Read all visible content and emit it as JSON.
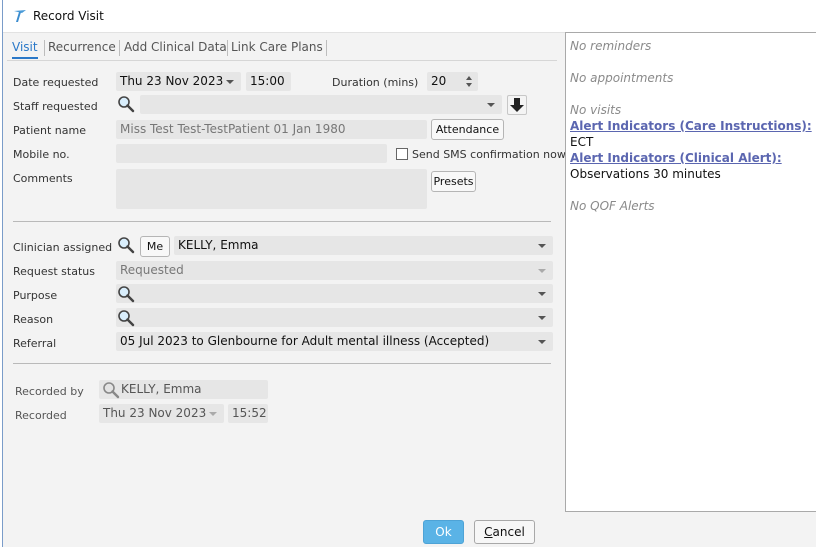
{
  "window": {
    "title": "Record Visit"
  },
  "tabs": [
    {
      "label": "Visit",
      "active": true
    },
    {
      "label": "Recurrence",
      "active": false
    },
    {
      "label": "Add Clinical Data",
      "active": false
    },
    {
      "label": "Link Care Plans",
      "active": false
    }
  ],
  "form": {
    "date_requested": {
      "label": "Date requested",
      "date": "Thu 23 Nov 2023",
      "time": "15:00"
    },
    "duration": {
      "label": "Duration (mins)",
      "value": "20"
    },
    "staff_requested": {
      "label": "Staff requested",
      "value": ""
    },
    "patient_name": {
      "label": "Patient name",
      "value": "Miss Test Test-TestPatient 01 Jan 1980",
      "button": "Attendance"
    },
    "mobile": {
      "label": "Mobile no.",
      "value": "",
      "sms_label": "Send SMS confirmation now",
      "sms_checked": false
    },
    "comments": {
      "label": "Comments",
      "value": "",
      "button": "Presets"
    },
    "clinician_assigned": {
      "label": "Clinician assigned",
      "me_button": "Me",
      "value": "KELLY, Emma"
    },
    "request_status": {
      "label": "Request status",
      "value": "Requested"
    },
    "purpose": {
      "label": "Purpose",
      "value": ""
    },
    "reason": {
      "label": "Reason",
      "value": ""
    },
    "referral": {
      "label": "Referral",
      "value": "05 Jul 2023 to Glenbourne for Adult mental illness (Accepted)"
    },
    "recorded_by": {
      "label": "Recorded by",
      "value": "KELLY, Emma"
    },
    "recorded": {
      "label": "Recorded",
      "date": "Thu 23 Nov 2023",
      "time": "15:52"
    }
  },
  "side_panel": {
    "reminders": "No reminders",
    "appointments": "No appointments",
    "visits": "No visits",
    "alert_care_heading": "Alert Indicators (Care Instructions):",
    "alert_care_value": "ECT",
    "alert_clinical_heading": "Alert Indicators (Clinical Alert):",
    "alert_clinical_value": "Observations 30 minutes",
    "qof": "No QOF Alerts"
  },
  "footer": {
    "ok_label": "Ok",
    "cancel_label": "Cancel"
  },
  "colors": {
    "accent": "#2a78c8",
    "ok_button": "#5ab3e6",
    "link": "#5b66b0"
  },
  "icons": [
    "app-logo-icon",
    "search-icon",
    "down-arrow-icon",
    "chevron-down-icon"
  ]
}
